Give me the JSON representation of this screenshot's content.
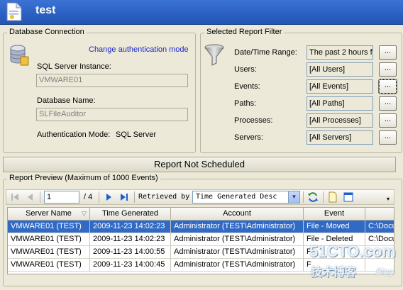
{
  "header": {
    "title": "test"
  },
  "db": {
    "legend": "Database Connection",
    "change_link": "Change authentication mode",
    "instance_label": "SQL Server Instance:",
    "instance_value": "VMWARE01",
    "dbname_label": "Database Name:",
    "dbname_value": "SLFileAuditor",
    "auth_label": "Authentication Mode:",
    "auth_value": "SQL Server"
  },
  "filter": {
    "legend": "Selected Report Filter",
    "rows": [
      {
        "label": "Date/Time Range:",
        "value": "The past 2 hours fr",
        "button": "..."
      },
      {
        "label": "Users:",
        "value": "[All Users]",
        "button": "..."
      },
      {
        "label": "Events:",
        "value": "[All Events]",
        "button": "..."
      },
      {
        "label": "Paths:",
        "value": "[All Paths]",
        "button": "..."
      },
      {
        "label": "Processes:",
        "value": "[All Processes]",
        "button": "..."
      },
      {
        "label": "Servers:",
        "value": "[All Servers]",
        "button": "..."
      }
    ]
  },
  "banner": "Report Not Scheduled",
  "preview": {
    "legend": "Report Preview (Maximum of 1000 Events)",
    "page_current": "1",
    "page_total": "/ 4",
    "retrieved_label": "Retrieved by",
    "sort_value": "Time Generated Desc",
    "columns": [
      "Server Name",
      "Time Generated",
      "Account",
      "Event",
      ""
    ],
    "rows": [
      [
        "VMWARE01 (TEST)",
        "2009-11-23 14:02:23",
        "Administrator  (TEST\\Administrator)",
        "File - Moved",
        "C:\\Docu"
      ],
      [
        "VMWARE01 (TEST)",
        "2009-11-23 14:02:23",
        "Administrator  (TEST\\Administrator)",
        "File - Deleted",
        "C:\\Docu"
      ],
      [
        "VMWARE01 (TEST)",
        "2009-11-23 14:00:55",
        "Administrator  (TEST\\Administrator)",
        "F",
        ""
      ],
      [
        "VMWARE01 (TEST)",
        "2009-11-23 14:00:45",
        "Administrator  (TEST\\Administrator)",
        "F",
        ""
      ]
    ]
  },
  "watermark": {
    "line1": "51CTO.com",
    "line2": "技术博客",
    "line3": "Blog"
  },
  "colors": {
    "header": "#2a5fc1",
    "selection": "#316ac5",
    "link": "#1a28c8"
  }
}
